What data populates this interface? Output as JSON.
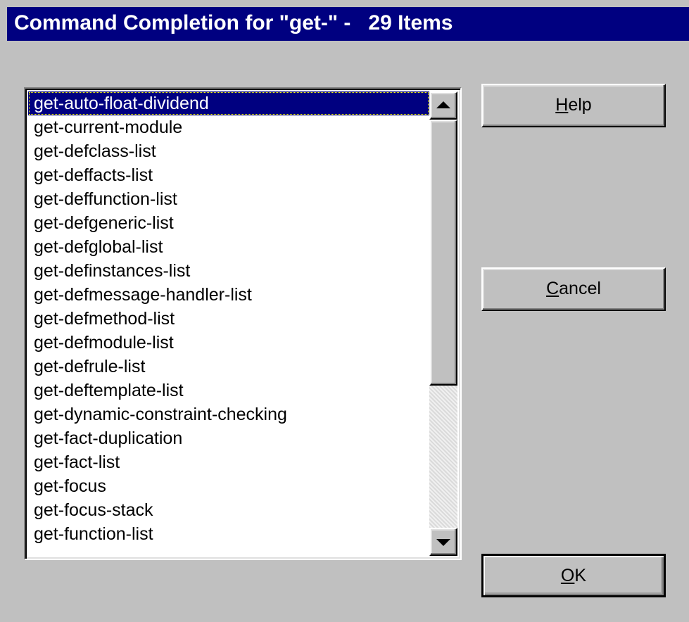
{
  "window": {
    "title": "Command Completion for \"get-\" -   29 Items"
  },
  "list": {
    "selected_index": 0,
    "items": [
      "get-auto-float-dividend",
      "get-current-module",
      "get-defclass-list",
      "get-deffacts-list",
      "get-deffunction-list",
      "get-defgeneric-list",
      "get-defglobal-list",
      "get-definstances-list",
      "get-defmessage-handler-list",
      "get-defmethod-list",
      "get-defmodule-list",
      "get-defrule-list",
      "get-deftemplate-list",
      "get-dynamic-constraint-checking",
      "get-fact-duplication",
      "get-fact-list",
      "get-focus",
      "get-focus-stack",
      "get-function-list"
    ]
  },
  "scrollbar": {
    "up_icon": "triangle-up",
    "down_icon": "triangle-down"
  },
  "buttons": {
    "help": {
      "mnemonic": "H",
      "rest": "elp"
    },
    "cancel": {
      "mnemonic": "C",
      "rest": "ancel"
    },
    "ok": {
      "mnemonic": "O",
      "rest": "K"
    }
  }
}
